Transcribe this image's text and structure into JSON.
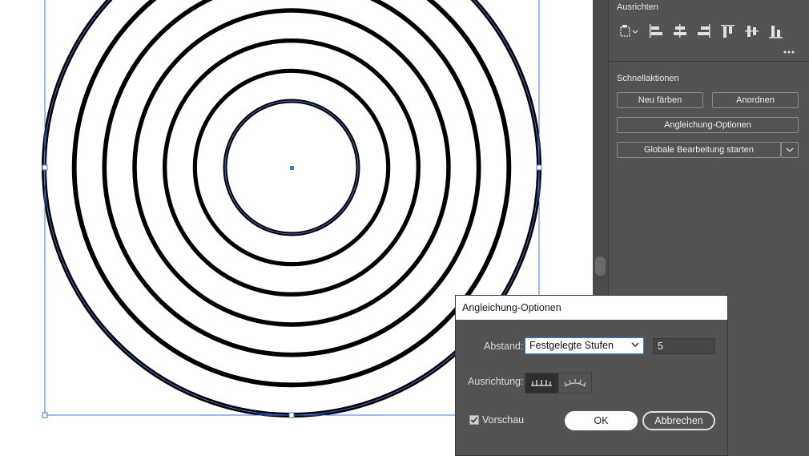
{
  "canvas": {
    "ring_count": 7,
    "selection_color": "#4a6fd9",
    "stroke_color": "#000000"
  },
  "panel": {
    "align_section_title": "Ausrichten",
    "align_icons": [
      "align-to-selection-icon",
      "align-left-edges-icon",
      "align-horizontal-centers-icon",
      "align-right-edges-icon",
      "align-top-edges-icon",
      "align-vertical-centers-icon",
      "align-bottom-edges-icon"
    ],
    "more_icon": "more-options-icon",
    "quick_actions_title": "Schnellaktionen",
    "recolor_label": "Neu färben",
    "arrange_label": "Anordnen",
    "blend_options_label": "Angleichung-Optionen",
    "global_edit_label": "Globale Bearbeitung starten"
  },
  "dialog": {
    "title": "Angleichung-Optionen",
    "spacing_label": "Abstand:",
    "spacing_value": "Festgelegte Stufen",
    "steps_value": "5",
    "orientation_label": "Ausrichtung:",
    "orientation_options": [
      "align-to-page-icon",
      "align-to-path-icon"
    ],
    "orientation_selected": "align-to-page-icon",
    "preview_label": "Vorschau",
    "preview_checked": true,
    "ok_label": "OK",
    "cancel_label": "Abbrechen"
  }
}
